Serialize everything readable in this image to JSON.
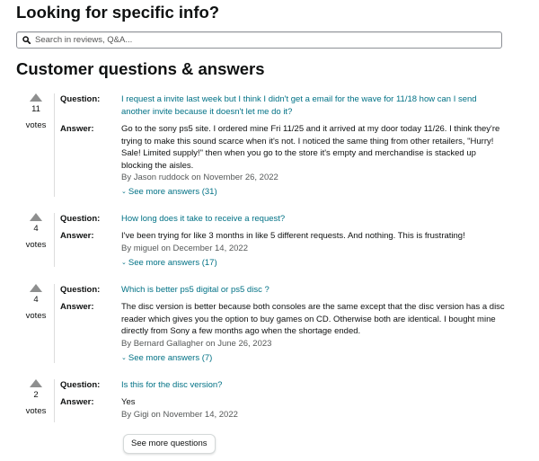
{
  "lookup": {
    "heading": "Looking for specific info?",
    "search_placeholder": "Search in reviews, Q&A..."
  },
  "qa": {
    "heading": "Customer questions & answers",
    "question_label": "Question:",
    "answer_label": "Answer:",
    "votes_label": "votes",
    "items": [
      {
        "votes": "11",
        "question": "I request a invite last week but I think I didn't get a email for the wave for 11/18 how can I send another invite because it doesn't let me do it?",
        "answer": "Go to the sony ps5 site. I ordered mine Fri 11/25 and it arrived at my door today 11/26. I think they're trying to make this sound scarce when it's not. I noticed the same thing from other retailers, \"Hurry! Sale! Limited supply!\" then when you go to the store it's empty and merchandise is stacked up blocking the aisles.",
        "byline": "By Jason ruddock on November 26, 2022",
        "more": "See more answers (31)"
      },
      {
        "votes": "4",
        "question": "How long does it take to receive a request?",
        "answer": "I've been trying for like 3 months in like 5 different requests. And nothing. This is frustrating!",
        "byline": "By miguel on December 14, 2022",
        "more": "See more answers (17)"
      },
      {
        "votes": "4",
        "question": "Which is better ps5 digital or ps5 disc ?",
        "answer": "The disc version is better because both consoles are the same except that the disc version has a disc reader which gives you the option to buy games on CD. Otherwise both are identical. I bought mine directly from Sony a few months ago when the shortage ended.",
        "byline": "By Bernard Gallagher on June 26, 2023",
        "more": "See more answers (7)"
      },
      {
        "votes": "2",
        "question": "Is this for the disc version?",
        "answer": "Yes",
        "byline": "By Gigi on November 14, 2022"
      }
    ],
    "see_more_questions": "See more questions"
  },
  "colors": {
    "link": "#007185",
    "vote_arrow": "#8e8f8f",
    "text": "#0f1111",
    "muted": "#565959"
  }
}
